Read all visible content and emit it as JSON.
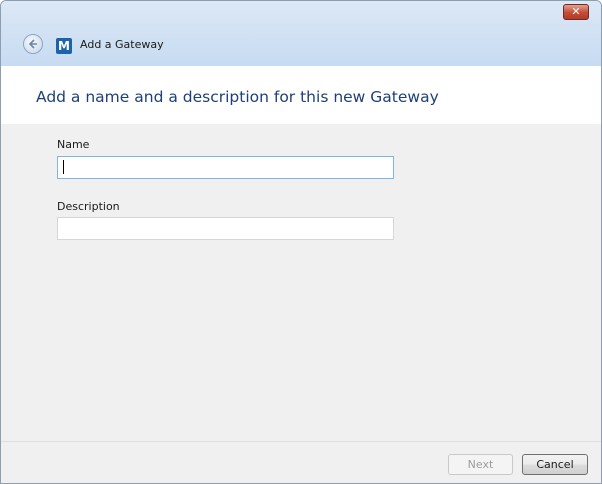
{
  "window": {
    "title": "Add a Gateway",
    "app_icon_letter": "M",
    "close_glyph": "✕",
    "accent": "#1f3f7a"
  },
  "page": {
    "heading": "Add a name and a description for this new Gateway"
  },
  "form": {
    "name_label": "Name",
    "name_value": "",
    "description_label": "Description",
    "description_value": ""
  },
  "footer": {
    "next_label": "Next",
    "next_enabled": false,
    "cancel_label": "Cancel"
  },
  "icons": [
    "close-icon",
    "back-arrow-icon",
    "app-logo-icon"
  ]
}
